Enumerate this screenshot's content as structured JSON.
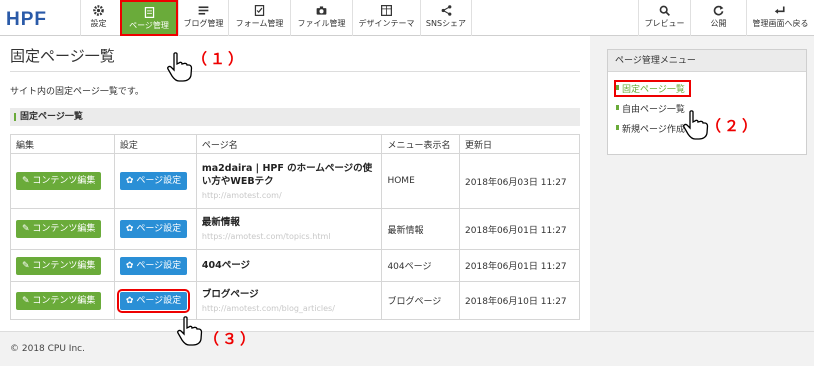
{
  "logo": "HPF",
  "nav": {
    "left": [
      {
        "label": "設定",
        "icon": "gear-icon"
      },
      {
        "label": "ページ管理",
        "icon": "page-icon"
      },
      {
        "label": "ブログ管理",
        "icon": "blog-icon"
      },
      {
        "label": "フォーム管理",
        "icon": "form-icon"
      },
      {
        "label": "ファイル管理",
        "icon": "camera-icon"
      },
      {
        "label": "デザインテーマ",
        "icon": "theme-icon"
      },
      {
        "label": "SNSシェア",
        "icon": "share-icon"
      }
    ],
    "right": [
      {
        "label": "プレビュー",
        "icon": "search-icon"
      },
      {
        "label": "公開",
        "icon": "refresh-icon"
      },
      {
        "label": "管理画面へ戻る",
        "icon": "return-icon"
      }
    ]
  },
  "main": {
    "title": "固定ページ一覧",
    "description": "サイト内の固定ページ一覧です。",
    "section_title": "固定ページ一覧"
  },
  "table": {
    "headers": [
      "編集",
      "設定",
      "ページ名",
      "メニュー表示名",
      "更新日"
    ],
    "edit_label": "コンテンツ編集",
    "setting_label": "ページ設定",
    "rows": [
      {
        "name": "ma2daira | HPF のホームページの使い方やWEBテク",
        "url": "http://amotest.com/",
        "menu": "HOME",
        "date": "2018年06月03日 11:27"
      },
      {
        "name": "最新情報",
        "url": "https://amotest.com/topics.html",
        "menu": "最新情報",
        "date": "2018年06月01日 11:27"
      },
      {
        "name": "404ページ",
        "url": "",
        "menu": "404ページ",
        "date": "2018年06月01日 11:27"
      },
      {
        "name": "ブログページ",
        "url": "http://amotest.com/blog_articles/",
        "menu": "ブログページ",
        "date": "2018年06月10日 11:27"
      }
    ]
  },
  "sidebar": {
    "title": "ページ管理メニュー",
    "items": [
      "固定ページ一覧",
      "自由ページ一覧",
      "新規ページ作成"
    ]
  },
  "steps": [
    "（１）",
    "（２）",
    "（３）"
  ],
  "footer": "© 2018 CPU Inc.",
  "colors": {
    "accent_green": "#6aab3a",
    "button_blue": "#2a8fd6",
    "highlight_red": "#ee0000"
  }
}
